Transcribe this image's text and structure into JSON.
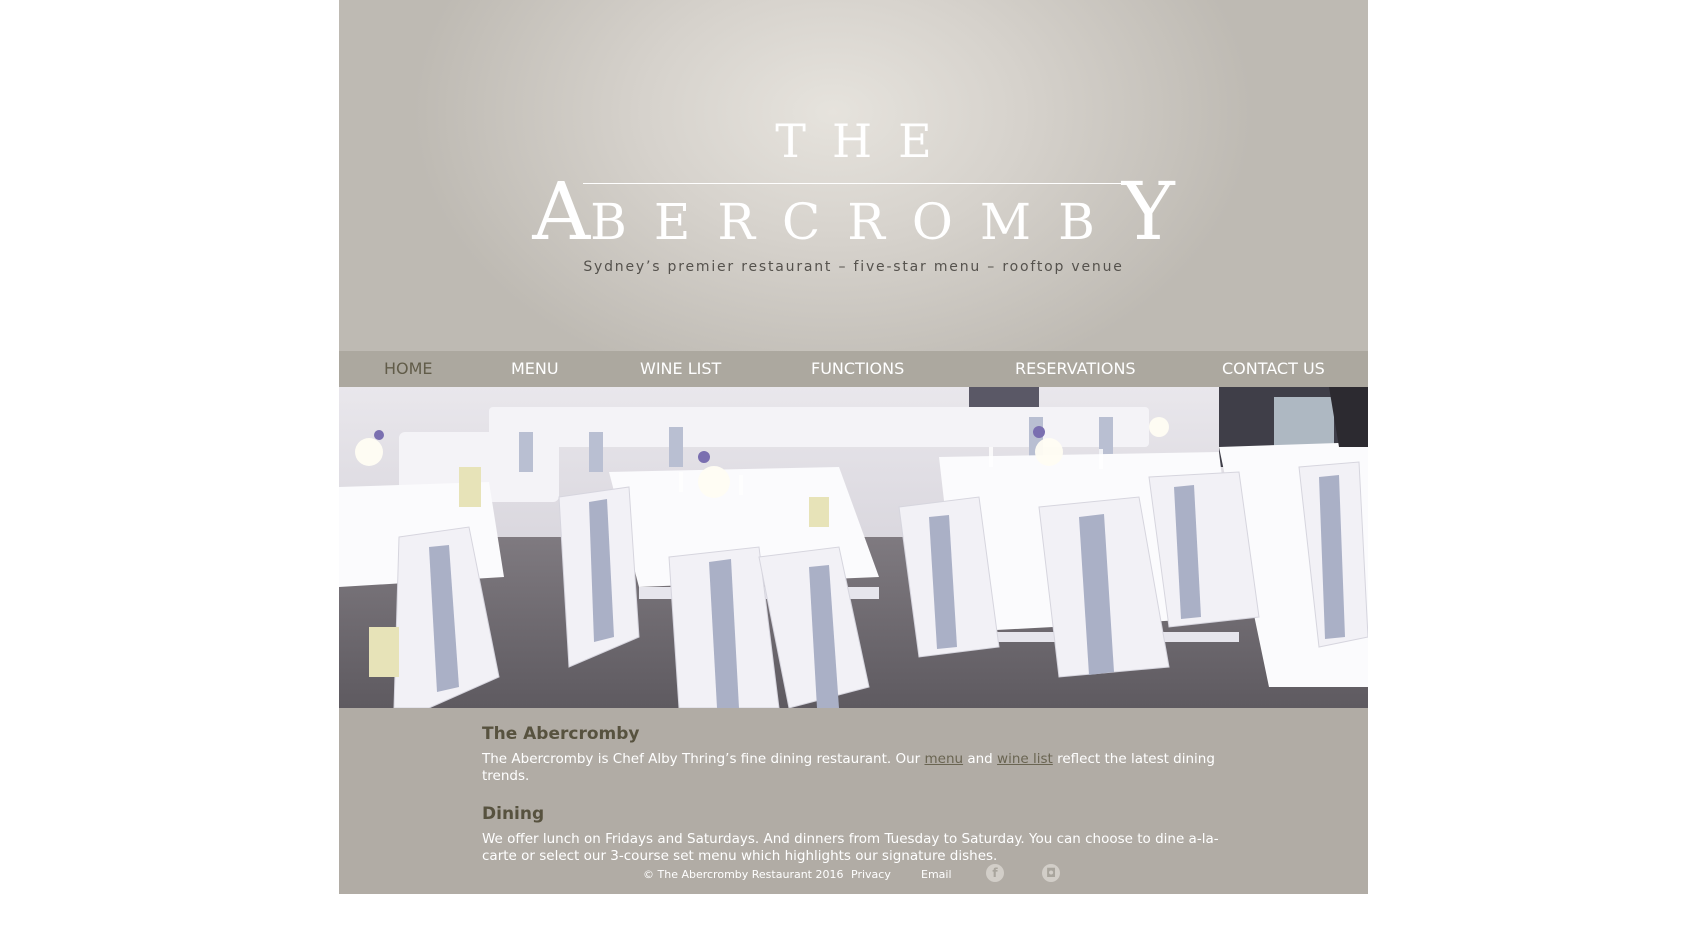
{
  "logo": {
    "the": "THE",
    "name_first": "A",
    "name_middle": "BERCROMB",
    "name_last": "Y",
    "tagline": "Sydney’s premier restaurant – five-star menu – rooftop venue"
  },
  "nav": {
    "items": [
      {
        "label": "HOME"
      },
      {
        "label": "MENU"
      },
      {
        "label": "WINE LIST"
      },
      {
        "label": "FUNCTIONS"
      },
      {
        "label": "RESERVATIONS"
      },
      {
        "label": "CONTACT US"
      }
    ],
    "active": "HOME"
  },
  "content": {
    "heading1": "The Abercromby",
    "para1_before": "The Abercromby is Chef Alby Thring’s fine dining restaurant. Our ",
    "para1_link1": "menu",
    "para1_mid": " and ",
    "para1_link2": "wine list",
    "para1_after": " reflect the latest dining trends.",
    "heading2": "Dining",
    "para2": "We offer lunch on Fridays and Saturdays. And dinners from Tuesday to Saturday. You can choose to dine a-la-carte or select our 3-course set menu which highlights our signature dishes."
  },
  "footer": {
    "copyright": "© The Abercromby Restaurant 2016",
    "privacy": "Privacy",
    "email": "Email",
    "facebook_glyph": "f",
    "instagram_glyph": "◘"
  },
  "icons": {
    "facebook": "facebook-icon",
    "instagram": "instagram-icon"
  },
  "colors": {
    "page_bg": "#b1aca5",
    "nav_bg": "#aca89f",
    "heading": "#57523f",
    "active_nav": "#615c49",
    "link": "#6a6552"
  }
}
